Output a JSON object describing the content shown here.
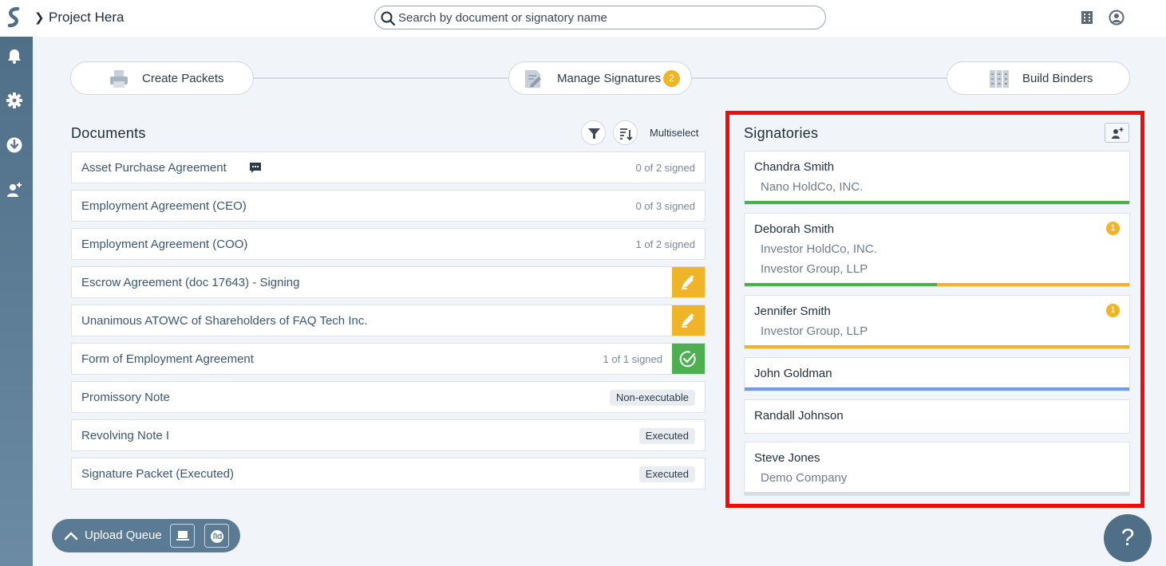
{
  "header": {
    "project_title": "Project Hera",
    "search_placeholder": "Search by document or signatory name"
  },
  "workflow": {
    "steps": [
      {
        "label": "Create Packets",
        "icon": "printer-icon"
      },
      {
        "label": "Manage Signatures",
        "icon": "document-sign-icon",
        "badge": "2"
      },
      {
        "label": "Build Binders",
        "icon": "binders-icon"
      }
    ]
  },
  "documents": {
    "title": "Documents",
    "multiselect_label": "Multiselect",
    "rows": [
      {
        "name": "Asset Purchase Agreement",
        "status": "0 of 2 signed",
        "has_comment": true
      },
      {
        "name": "Employment Agreement (CEO)",
        "status": "0 of 3 signed"
      },
      {
        "name": "Employment Agreement (COO)",
        "status": "1 of 2 signed"
      },
      {
        "name": "Escrow Agreement (doc 17643) - Signing",
        "action": "sign-action"
      },
      {
        "name": "Unanimous ATOWC of Shareholders of FAQ Tech Inc.",
        "action": "sign-action"
      },
      {
        "name": "Form of Employment Agreement",
        "status": "1 of 1 signed",
        "action": "complete-action"
      },
      {
        "name": "Promissory Note",
        "pill": "Non-executable"
      },
      {
        "name": "Revolving Note I",
        "pill": "Executed"
      },
      {
        "name": "Signature Packet (Executed)",
        "pill": "Executed"
      }
    ]
  },
  "signatories": {
    "title": "Signatories",
    "cards": [
      {
        "name": "Chandra Smith",
        "orgs": [
          "Nano HoldCo, INC."
        ]
      },
      {
        "name": "Deborah Smith",
        "orgs": [
          "Investor HoldCo, INC.",
          "Investor Group, LLP"
        ],
        "badge": "1"
      },
      {
        "name": "Jennifer Smith",
        "orgs": [
          "Investor Group, LLP"
        ],
        "badge": "1"
      },
      {
        "name": "John Goldman",
        "orgs": []
      },
      {
        "name": "Randall Johnson",
        "orgs": []
      },
      {
        "name": "Steve Jones",
        "orgs": [
          "Demo Company"
        ]
      }
    ]
  },
  "upload_queue": {
    "label": "Upload Queue"
  },
  "help": {
    "label": "?"
  },
  "colors": {
    "accent_orange": "#f0b429",
    "success_green": "#4caf50",
    "info_blue": "#6f9be8",
    "rail": "#4f6f88",
    "highlight_red": "#f00a0a"
  }
}
